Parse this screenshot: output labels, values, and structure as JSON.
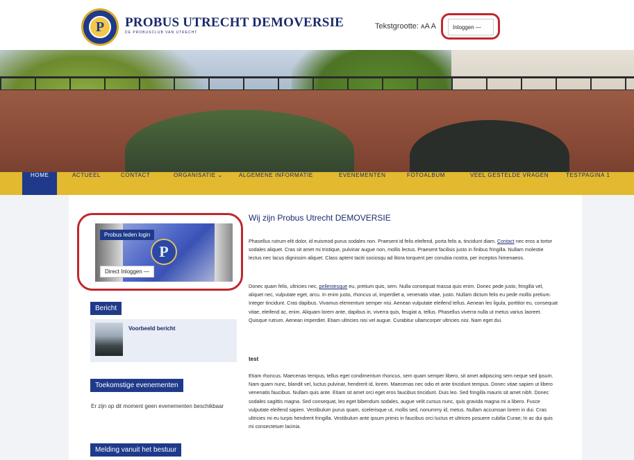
{
  "header": {
    "site_title": "PROBUS UTRECHT DEMOVERSIE",
    "site_subtitle": "DE PROBUSCLUB VAN UTRECHT",
    "text_size_label": "Tekstgrootte: ᴀA A",
    "login_label": "Inloggen —",
    "logo_letter": "P"
  },
  "nav": {
    "items": [
      "HOME",
      "ACTUEEL",
      "CONTACT",
      "ORGANISATIE ⌄",
      "ALGEMENE INFORMATIE",
      "EVENEMENTEN",
      "FOTOALBUM",
      "VEEL GESTELDE VRAGEN",
      "TESTPAGINA 1"
    ],
    "active": "HOME"
  },
  "sidebar": {
    "login_widget": {
      "title": "Probus leden login",
      "direct_login": "Direct Inloggen —",
      "seal_letter": "P"
    },
    "bericht_title": "Bericht",
    "post_title": "Voorbeeld bericht",
    "events_title": "Toekomstige evenementen",
    "events_text": "Er zijn op dit moment geen evenementen beschikbaar",
    "board_title": "Melding vanuit het bestuur"
  },
  "main": {
    "title": "Wij zijn Probus Utrecht DEMOVERSIE",
    "para1_before": "Phasellus rutrum elit dolor, id euismod purus sodales non. Praesent id felis eleifend, porta felis a, tincidunt diam.",
    "para1_link": "Contact",
    "para1_after": "nec eros a tortor sodales aliquet. Cras sit amet mi tristique, pulvinar augue non, mollis lectus. Praesent facilisis justo in finibus fringilla. Nullam molestie lectus nec lacus dignissim aliquet. Class aptent taciti sociosqu ad litora torquent per conubia nostra, per inceptos himenaeos.",
    "para2_before": "Donec quam felis, ultricies nec,",
    "para2_link": "pellentesque",
    "para2_after": "eu, pretium quis, sem. Nulla consequat massa quis enim. Donec pede justo, fringilla vel, aliquet nec, vulputate eget, arcu. In enim justo, rhoncus ut, imperdiet a, venenatis vitae, justo. Nullam dictum felis eu pede mollis pretium. Integer tincidunt. Cras dapibus. Vivamus elementum semper nisi. Aenean vulputate eleifend tellus. Aenean leo ligula, porttitor eu, consequat vitae, eleifend ac, enim. Aliquam lorem ante, dapibus in, viverra quis, feugiat a, tellus. Phasellus viverra nulla ut metus varius laoreet. Quisque rutrum. Aenean imperdiet. Etiam ultricies nisi vel augue. Curabitur ullamcorper ultricies nisi. Nam eget dui.",
    "subhead": "test",
    "para3": "Etiam rhoncus. Maecenas tempus, tellus eget condimentum rhoncus, sem quam semper libero, sit amet adipiscing sem neque sed ipsum. Nam quam nunc, blandit vel, luctus pulvinar, hendrerit id, lorem. Maecenas nec odio et ante tincidunt tempus. Donec vitae sapien ut libero venenatis faucibus. Nullam quis ante. Etiam sit amet orci eget eros faucibus tincidunt. Duis leo. Sed fringilla mauris sit amet nibh. Donec sodales sagittis magna. Sed consequat, leo eget bibendum sodales, augue velit cursus nunc, quis gravida magna mi a libero. Fusce vulputate eleifend sapien. Vestibulum purus quam, scelerisque ut, mollis sed, nonummy id, metus. Nullam accumsan lorem in dui. Cras ultricies mi eu turpis hendrerit fringilla. Vestibulum ante ipsum primis in faucibus orci luctus et ultrices posuere cubilia Curae; In ac dui quis mi consectetuer lacinia."
  },
  "colors": {
    "brand_blue": "#1f3a8a",
    "nav_yellow": "#e2b92f",
    "highlight_red": "#c0262d"
  }
}
